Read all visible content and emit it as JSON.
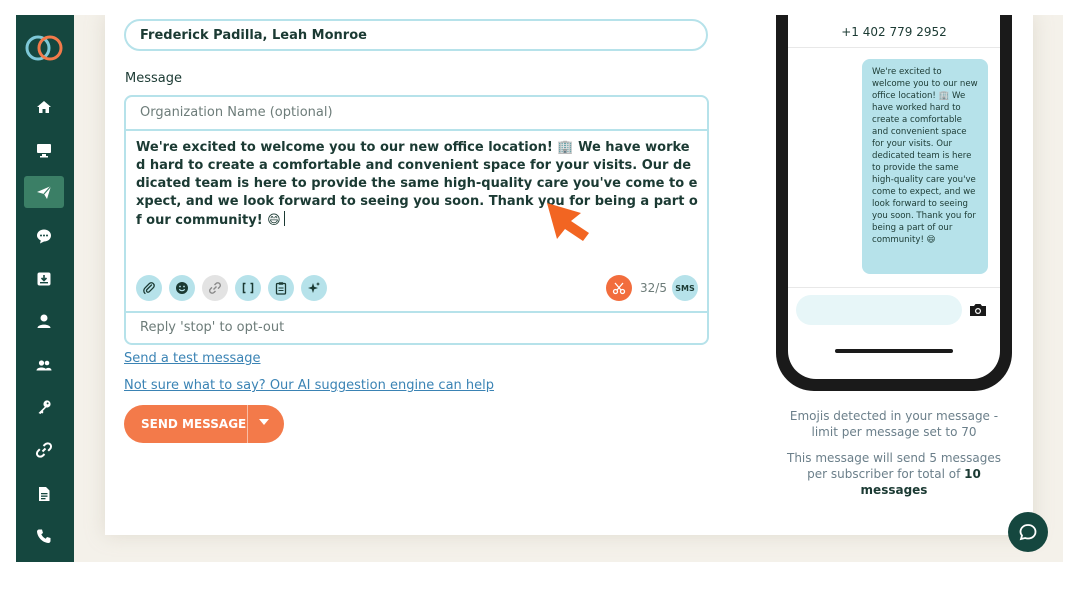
{
  "sidebar": {
    "items": [
      {
        "icon": "home-icon",
        "name": "home"
      },
      {
        "icon": "monitor-icon",
        "name": "dashboard"
      },
      {
        "icon": "send-icon",
        "name": "send",
        "active": true
      },
      {
        "icon": "chat-icon",
        "name": "conversations"
      },
      {
        "icon": "inbox-download-icon",
        "name": "inbox"
      },
      {
        "icon": "user-icon",
        "name": "contacts"
      },
      {
        "icon": "users-icon",
        "name": "groups"
      },
      {
        "icon": "key-icon",
        "name": "keywords"
      },
      {
        "icon": "link-icon",
        "name": "links"
      },
      {
        "icon": "document-icon",
        "name": "documents"
      },
      {
        "icon": "phone-icon",
        "name": "calls"
      }
    ],
    "colors": {
      "bg": "#15473f",
      "active": "#3b7f66"
    }
  },
  "form": {
    "recipients_value": "Frederick Padilla, Leah Monroe",
    "message_label": "Message",
    "org_name_placeholder": "Organization Name (optional)",
    "message_text": "We're excited to welcome you to our new office location! 🏢 We have worked hard to create a comfortable and convenient space for your visits. Our dedicated team is here to provide the same high-quality care you've come to expect, and we look forward to seeing you soon. Thank you for being a part of our community! 😄",
    "toolbar_icons": [
      "paperclip-icon",
      "smiley-icon",
      "link-icon",
      "brackets-icon",
      "clipboard-icon",
      "sparkle-icon"
    ],
    "counter": "32/5",
    "sms_badge": "SMS",
    "optout_text": "Reply 'stop' to opt-out",
    "test_link": "Send a test message",
    "ai_link": "Not sure what to say? Our AI suggestion engine can help",
    "send_label": "SEND MESSAGE"
  },
  "preview": {
    "phone_number": "+1 402 779 2952",
    "bubble_text": "We're excited to welcome you to our new office location! 🏢 We have worked hard to create a comfortable and convenient space for your visits. Our dedicated team is here to provide the same high-quality care you've come to expect, and we look forward to seeing you soon. Thank you for being a part of our community! 😄",
    "emoji_note": "Emojis detected in your message - limit per message set to 70",
    "count_note_prefix": "This message will send 5 messages per subscriber for total of",
    "count_note_total": "10 messages"
  },
  "colors": {
    "accent": "#f37a4a",
    "border": "#b6e2ea",
    "link": "#3a83b4",
    "text": "#1b3a33"
  }
}
